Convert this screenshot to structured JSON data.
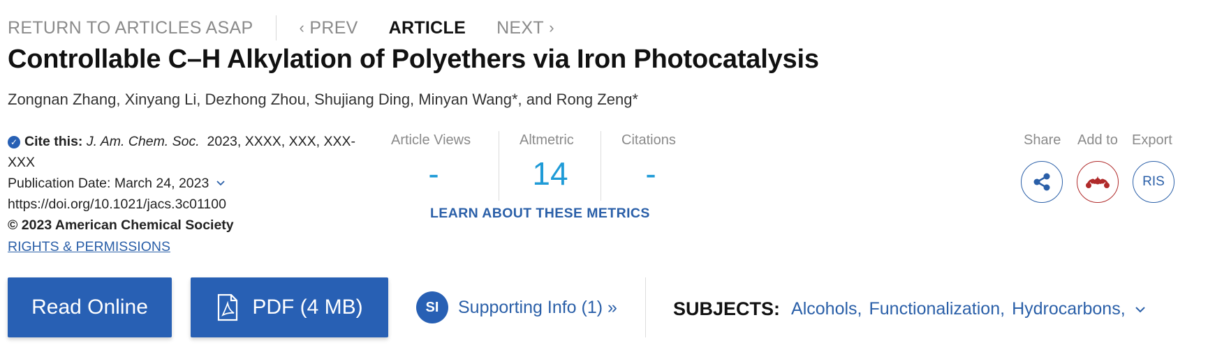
{
  "nav": {
    "return_label": "RETURN TO ARTICLES ASAP",
    "prev_label": "PREV",
    "current_label": "ARTICLE",
    "next_label": "NEXT"
  },
  "article": {
    "title": "Controllable C–H Alkylation of Polyethers via Iron Photocatalysis",
    "authors": "Zongnan Zhang, Xinyang Li, Dezhong Zhou, Shujiang Ding, Minyan Wang*, and Rong Zeng*"
  },
  "citation": {
    "cite_label": "Cite this:",
    "journal": "J. Am. Chem. Soc.",
    "ref": "2023, XXXX, XXX, XXX-XXX",
    "publication_date": "Publication Date: March 24, 2023",
    "doi": "https://doi.org/10.1021/jacs.3c01100",
    "copyright": "© 2023 American Chemical Society",
    "rights_label": "RIGHTS & PERMISSIONS"
  },
  "metrics": {
    "views_label": "Article Views",
    "views_value": "-",
    "altmetric_label": "Altmetric",
    "altmetric_value": "14",
    "citations_label": "Citations",
    "citations_value": "-",
    "learn_label": "LEARN ABOUT THESE METRICS"
  },
  "actions": {
    "share_label": "Share",
    "addto_label": "Add to",
    "export_label": "Export",
    "export_button": "RIS"
  },
  "buttons": {
    "read_online": "Read Online",
    "pdf": "PDF (4 MB)",
    "si_badge": "SI",
    "supporting_info": "Supporting Info (1) »"
  },
  "subjects": {
    "label": "SUBJECTS:",
    "items": [
      "Alcohols",
      "Functionalization",
      "Hydrocarbons"
    ]
  },
  "colors": {
    "accent": "#2860b4",
    "link": "#2a5fa8",
    "metric": "#1f9bd7",
    "mendeley": "#b02a2a"
  }
}
